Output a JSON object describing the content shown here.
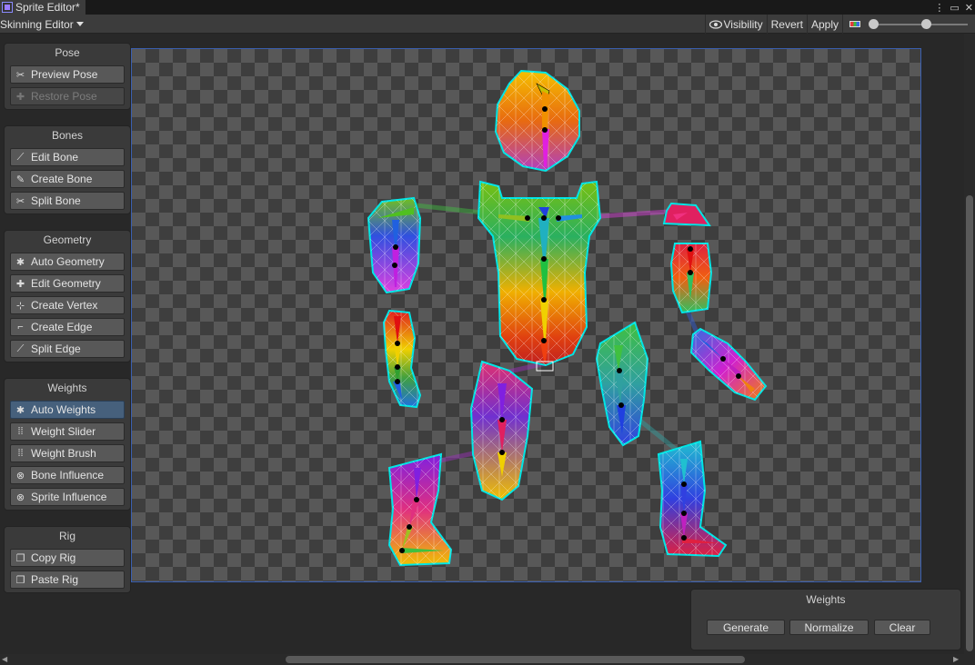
{
  "window": {
    "tab_title": "Sprite Editor*",
    "controls": [
      "⋮",
      "▭",
      "✕"
    ]
  },
  "toolbar": {
    "mode_label": "Skinning Editor",
    "visibility_label": "Visibility",
    "revert_label": "Revert",
    "apply_label": "Apply"
  },
  "panels": {
    "pose": {
      "title": "Pose",
      "preview": "Preview Pose",
      "restore": "Restore Pose"
    },
    "bones": {
      "title": "Bones",
      "edit": "Edit Bone",
      "create": "Create Bone",
      "split": "Split Bone"
    },
    "geometry": {
      "title": "Geometry",
      "auto": "Auto Geometry",
      "edit": "Edit Geometry",
      "create_vertex": "Create Vertex",
      "create_edge": "Create Edge",
      "split_edge": "Split Edge"
    },
    "weights": {
      "title": "Weights",
      "auto": "Auto Weights",
      "slider": "Weight Slider",
      "brush": "Weight Brush",
      "bone_influence": "Bone Influence",
      "sprite_influence": "Sprite Influence"
    },
    "rig": {
      "title": "Rig",
      "copy": "Copy Rig",
      "paste": "Paste Rig"
    }
  },
  "weights_window": {
    "title": "Weights",
    "generate": "Generate",
    "normalize": "Normalize",
    "clear": "Clear"
  },
  "colors": {
    "mesh_outline": "#00e5e5",
    "active_tool": "#46607c",
    "canvas_border": "#3a5fb0"
  }
}
